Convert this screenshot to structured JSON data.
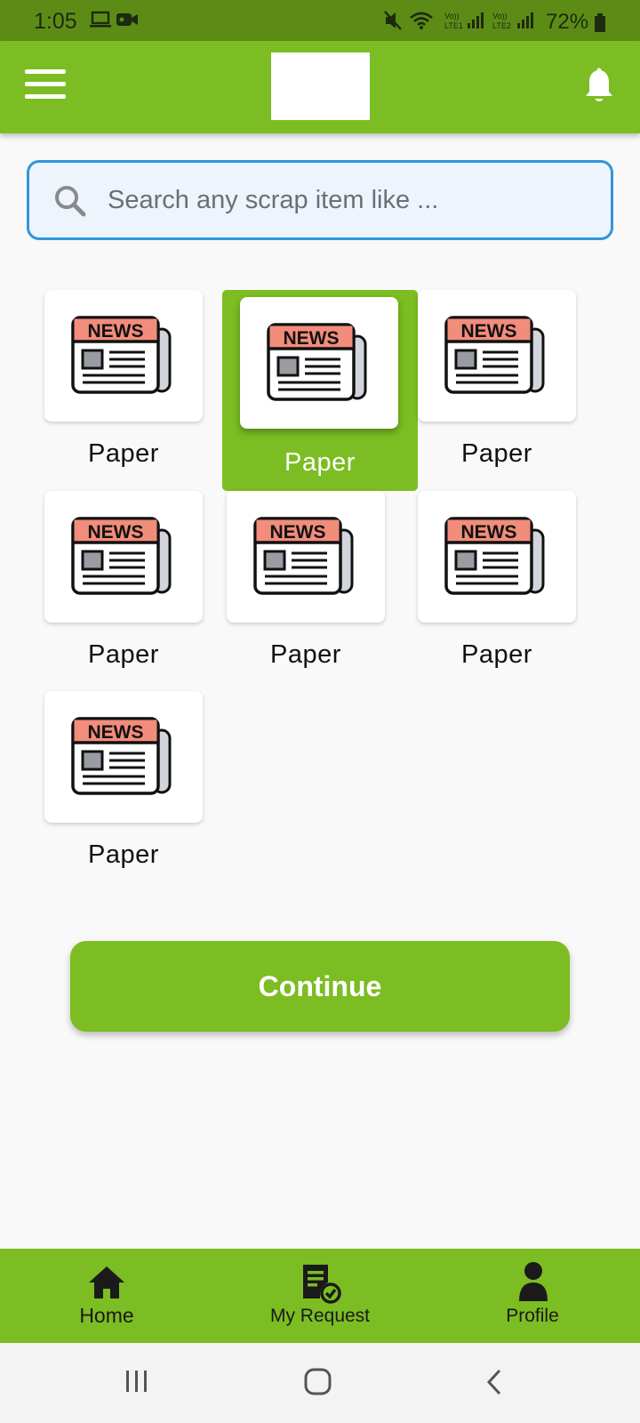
{
  "status_bar": {
    "time": "1:05",
    "battery": "72%",
    "icons": [
      "laptop-icon",
      "video-camera-icon",
      "mute-icon",
      "wifi-icon",
      "lte1-signal-icon",
      "lte2-signal-icon",
      "battery-icon"
    ]
  },
  "app_bar": {
    "menu_icon": "hamburger-menu-icon",
    "logo": "app-logo",
    "notification_icon": "bell-icon",
    "brand_color": "#7bbd22"
  },
  "search": {
    "placeholder": "Search any scrap item like ...",
    "value": "",
    "border_color": "#2f95e0"
  },
  "categories": [
    {
      "label": "Paper",
      "icon": "newspaper-icon",
      "selected": false
    },
    {
      "label": "Paper",
      "icon": "newspaper-icon",
      "selected": true
    },
    {
      "label": "Paper",
      "icon": "newspaper-icon",
      "selected": false
    },
    {
      "label": "Paper",
      "icon": "newspaper-icon",
      "selected": false
    },
    {
      "label": "Paper",
      "icon": "newspaper-icon",
      "selected": false
    },
    {
      "label": "Paper",
      "icon": "newspaper-icon",
      "selected": false
    },
    {
      "label": "Paper",
      "icon": "newspaper-icon",
      "selected": false
    }
  ],
  "icon_text": {
    "news": "NEWS"
  },
  "continue_label": "Continue",
  "bottom_nav": [
    {
      "label": "Home",
      "icon": "home-icon"
    },
    {
      "label": "My Request",
      "icon": "request-list-icon"
    },
    {
      "label": "Profile",
      "icon": "person-icon"
    }
  ],
  "system_nav": [
    "recent-apps-icon",
    "home-circle-icon",
    "back-icon"
  ]
}
